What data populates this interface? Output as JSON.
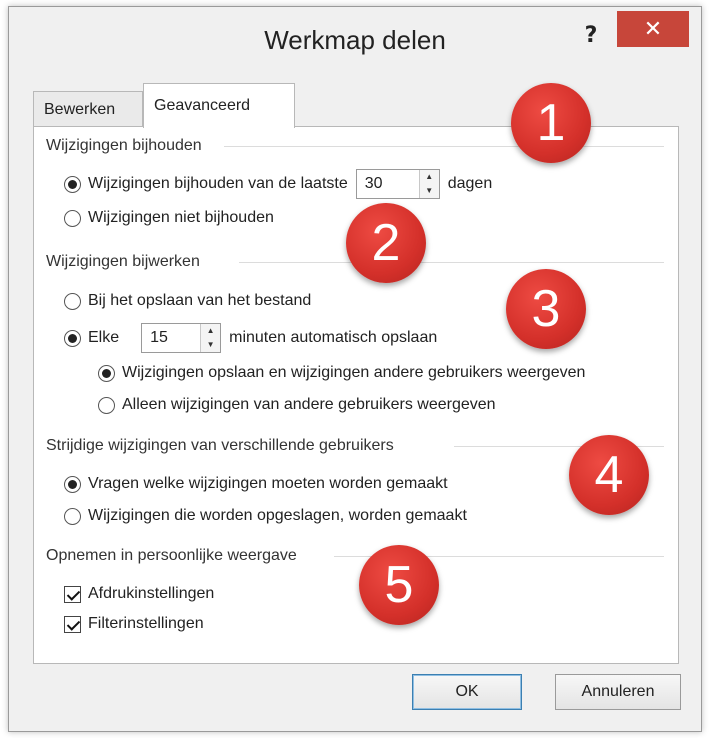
{
  "window": {
    "title": "Werkmap delen",
    "help_label": "?",
    "close_label": "✕"
  },
  "tabs": [
    {
      "label": "Bewerken",
      "active": false
    },
    {
      "label": "Geavanceerd",
      "active": true
    }
  ],
  "track_changes": {
    "heading": "Wijzigingen bijhouden",
    "option_keep": "Wijzigingen bijhouden van de laatste",
    "days_value": "30",
    "days_unit": "dagen",
    "option_none": "Wijzigingen niet bijhouden",
    "selected": "keep"
  },
  "update_changes": {
    "heading": "Wijzigingen bijwerken",
    "option_on_save": "Bij het opslaan van het bestand",
    "option_every": "Elke",
    "minutes_value": "15",
    "minutes_unit": "minuten automatisch opslaan",
    "sub_save_and_view": "Wijzigingen opslaan en wijzigingen andere gebruikers weergeven",
    "sub_view_only": "Alleen wijzigingen van andere gebruikers weergeven",
    "selected": "every",
    "sub_selected": "save_and_view"
  },
  "conflicts": {
    "heading": "Strijdige wijzigingen van verschillende gebruikers",
    "option_ask": "Vragen welke wijzigingen moeten worden gemaakt",
    "option_saved_wins": "Wijzigingen die worden opgeslagen, worden gemaakt",
    "selected": "ask"
  },
  "personal_view": {
    "heading": "Opnemen in persoonlijke weergave",
    "print_settings": "Afdrukinstellingen",
    "filter_settings": "Filterinstellingen",
    "print_checked": true,
    "filter_checked": true
  },
  "badges": [
    "1",
    "2",
    "3",
    "4",
    "5"
  ],
  "buttons": {
    "ok": "OK",
    "cancel": "Annuleren"
  },
  "colors": {
    "badge": "#d4302a",
    "close_button": "#c7463a",
    "default_button_border": "#3c7fb1"
  }
}
